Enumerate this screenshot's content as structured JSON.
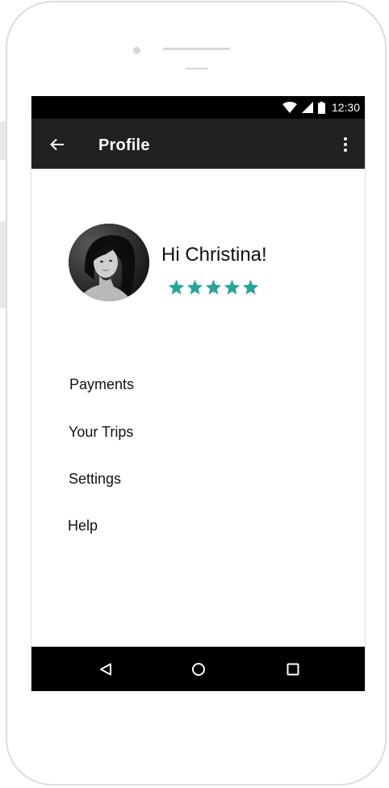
{
  "status_bar": {
    "time": "12:30",
    "icons": [
      "wifi-icon",
      "signal-icon",
      "battery-icon"
    ]
  },
  "app_bar": {
    "title": "Profile",
    "back_icon": "arrow-left-icon",
    "menu_icon": "more-vert-icon"
  },
  "profile": {
    "greeting": "Hi Christina!",
    "rating": 5,
    "rating_max": 5,
    "star_color": "#26a69a"
  },
  "menu": {
    "items": [
      {
        "label": "Payments"
      },
      {
        "label": "Your Trips"
      },
      {
        "label": "Settings"
      },
      {
        "label": "Help"
      }
    ]
  },
  "nav_bar": {
    "icons": [
      "nav-back-icon",
      "nav-home-icon",
      "nav-recents-icon"
    ]
  },
  "colors": {
    "app_bar": "#212121",
    "status_bar": "#000000",
    "accent": "#26a69a"
  }
}
